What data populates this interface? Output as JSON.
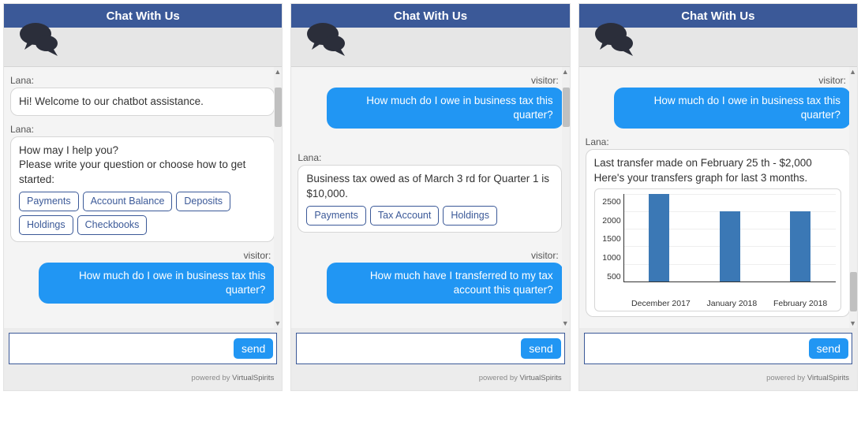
{
  "header": {
    "title": "Chat With Us"
  },
  "bot_name": "Lana",
  "visitor_name": "visitor",
  "send_label": "send",
  "footer": {
    "prefix": "powered by ",
    "brand": "VirtualSpirits"
  },
  "panel1": {
    "msg1": {
      "sender": "Lana:",
      "text": "Hi! Welcome to our chatbot assistance."
    },
    "msg2": {
      "sender": "Lana:",
      "line1": "How may I help you?",
      "line2": "Please write your question or choose how to get started:",
      "chips": [
        "Payments",
        "Account Balance",
        "Deposits",
        "Holdings",
        "Checkbooks"
      ]
    },
    "msg3": {
      "sender": "visitor:",
      "text": "How much do I owe in business tax this quarter?"
    }
  },
  "panel2": {
    "msg1": {
      "sender": "visitor:",
      "text": "How much do I owe in business tax this quarter?"
    },
    "msg2": {
      "sender": "Lana:",
      "text": "Business tax owed as of March 3 rd for Quarter 1 is $10,000.",
      "chips": [
        "Payments",
        "Tax Account",
        "Holdings"
      ]
    },
    "msg3": {
      "sender": "visitor:",
      "text": "How much have I transferred to my tax account this quarter?"
    }
  },
  "panel3": {
    "msg1": {
      "sender": "visitor:",
      "text": "How much do I owe in business tax this quarter?"
    },
    "msg2": {
      "sender": "Lana:",
      "line1": "Last transfer made on February 25 th - $2,000",
      "line2": "Here's your transfers graph for last 3 months."
    }
  },
  "chart_data": {
    "type": "bar",
    "categories": [
      "December 2017",
      "January 2018",
      "February 2018"
    ],
    "values": [
      2500,
      2000,
      2000
    ],
    "ylim": [
      0,
      2500
    ],
    "yticks": [
      2500,
      2000,
      1500,
      1000,
      500
    ],
    "title": "",
    "xlabel": "",
    "ylabel": ""
  }
}
